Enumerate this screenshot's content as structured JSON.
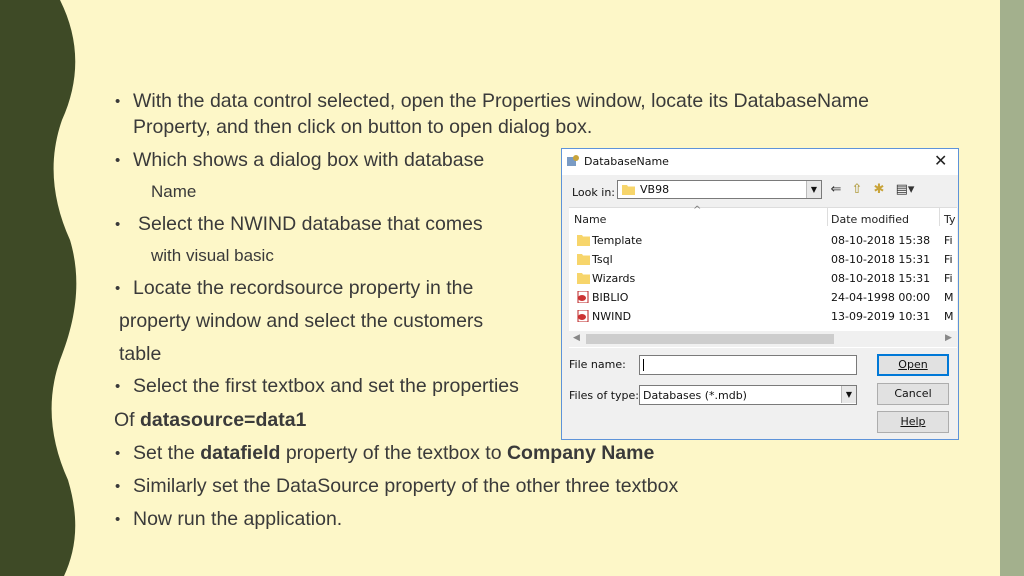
{
  "slide": {
    "bullets": [
      {
        "line1": "With the data control selected, open the Properties window, locate its DatabaseName",
        "line2": "Property, and then click on button to open dialog box."
      },
      {
        "text": "Which shows a dialog box with database",
        "sub": "Name"
      },
      {
        "text": "Select the NWIND database that comes",
        "sub": "with visual basic"
      },
      {
        "text": "Locate the recordsource property in the",
        "cont1": "property window and select the customers",
        "cont2": "table"
      },
      {
        "text": "Select the first textbox and set the properties"
      }
    ],
    "of_line": {
      "prefix": "Of ",
      "bold": "datasource=data1"
    },
    "bullet6": {
      "prefix": "Set the ",
      "bold1": "datafield",
      "middle": " property of the textbox to ",
      "bold2": "Company Name"
    },
    "bullet7": "Similarly set the DataSource property of the other three textbox",
    "bullet8": "Now run the application.",
    "bullet_symbol": "•"
  },
  "colors": {
    "background": "#fdf7c8",
    "left_band": "#3e4a26",
    "right_band": "#a3b08d",
    "folder": "#f7d56b"
  },
  "dialog": {
    "title": "DatabaseName",
    "close_symbol": "✕",
    "look_in_label": "Look in:",
    "look_in_value": "VB98",
    "tools": {
      "back": "⇐",
      "up": "⇧",
      "new_folder": "✱",
      "view_menu": "▤▾"
    },
    "columns": [
      "Name",
      "Date modified",
      "Ty"
    ],
    "rows": [
      {
        "name": "Template",
        "date": "08-10-2018 15:38",
        "type": "Fi",
        "icon": "folder-icon"
      },
      {
        "name": "Tsql",
        "date": "08-10-2018 15:31",
        "type": "Fi",
        "icon": "folder-icon"
      },
      {
        "name": "Wizards",
        "date": "08-10-2018 15:31",
        "type": "Fi",
        "icon": "folder-icon"
      },
      {
        "name": "BIBLIO",
        "date": "24-04-1998 00:00",
        "type": "M",
        "icon": "database-file-icon"
      },
      {
        "name": "NWIND",
        "date": "13-09-2019 10:31",
        "type": "M",
        "icon": "database-file-icon"
      }
    ],
    "file_name_label": "File name:",
    "file_name_value": "",
    "files_of_type_label": "Files of type:",
    "files_of_type_value": "Databases (*.mdb)",
    "buttons": {
      "open": "Open",
      "cancel": "Cancel",
      "help": "Help"
    }
  }
}
